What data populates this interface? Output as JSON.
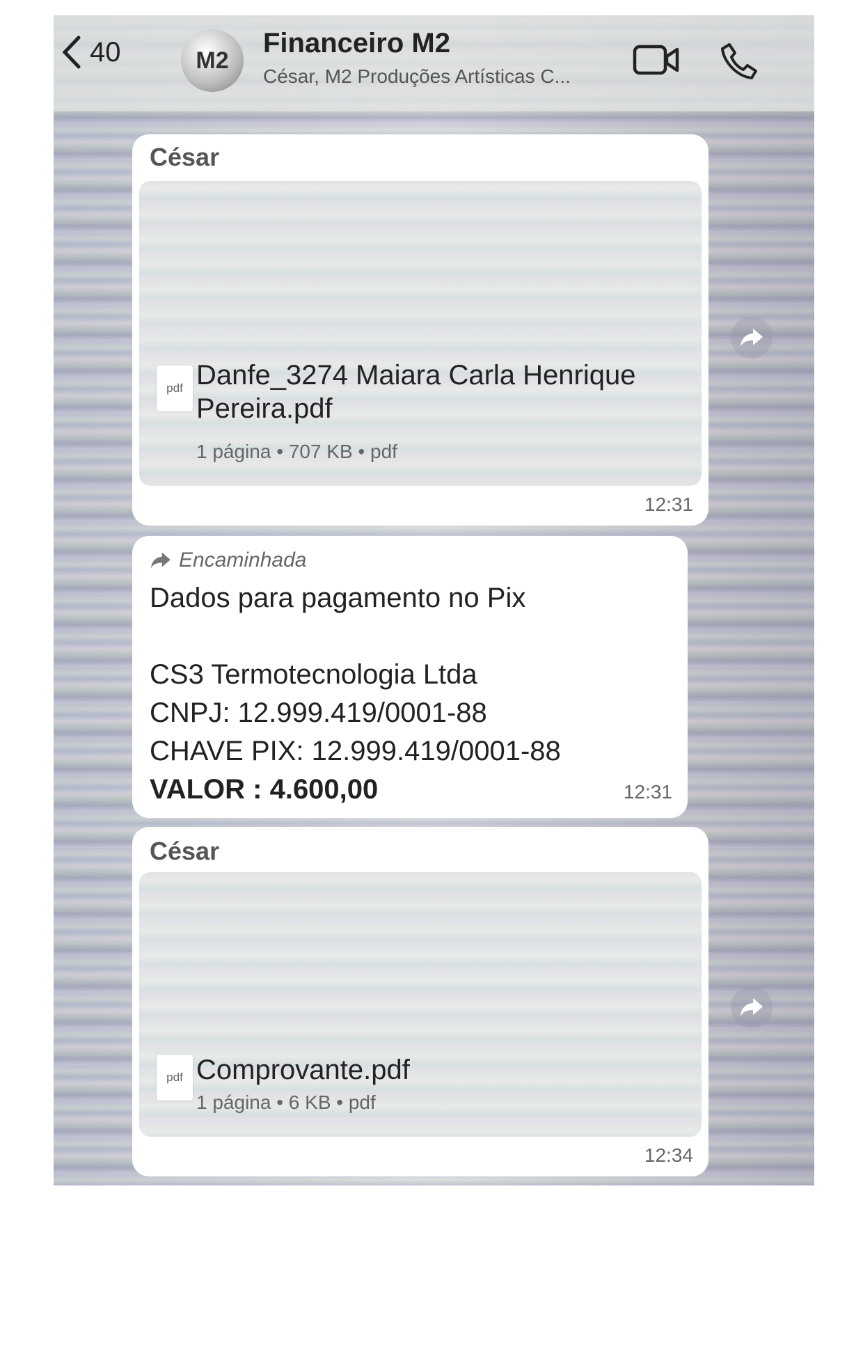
{
  "header": {
    "back_count": "40",
    "avatar_text": "M2",
    "title": "Financeiro M2",
    "subtitle": "César, M2 Produções Artísticas C..."
  },
  "messages": [
    {
      "sender": "César",
      "file_icon": "pdf",
      "file_name": "Danfe_3274 Maiara Carla Henrique Pereira.pdf",
      "file_meta": "1 página • 707 KB • pdf",
      "time": "12:31"
    },
    {
      "forwarded_label": "Encaminhada",
      "lines": [
        "Dados para pagamento no Pix",
        "",
        "CS3 Termotecnologia Ltda",
        "CNPJ: 12.999.419/0001-88",
        "CHAVE PIX: 12.999.419/0001-88"
      ],
      "bold_line": "VALOR : 4.600,00",
      "time": "12:31"
    },
    {
      "sender": "César",
      "file_icon": "pdf",
      "file_name": "Comprovante.pdf",
      "file_meta": "1 página • 6 KB • pdf",
      "time": "12:34"
    }
  ]
}
